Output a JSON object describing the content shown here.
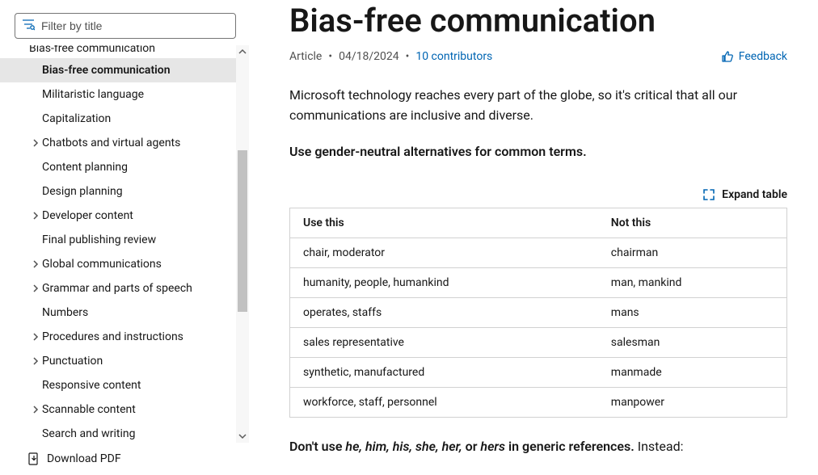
{
  "filter": {
    "placeholder": "Filter by title"
  },
  "sidebar": {
    "truncated_top": "Bias-free communication",
    "items": [
      {
        "label": "Bias-free communication",
        "indent": 2,
        "caret": false,
        "selected": true
      },
      {
        "label": "Militaristic language",
        "indent": 2,
        "caret": false,
        "selected": false
      },
      {
        "label": "Capitalization",
        "indent": 1,
        "caret": false,
        "selected": false
      },
      {
        "label": "Chatbots and virtual agents",
        "indent": 1,
        "caret": true,
        "selected": false
      },
      {
        "label": "Content planning",
        "indent": 1,
        "caret": false,
        "selected": false
      },
      {
        "label": "Design planning",
        "indent": 1,
        "caret": false,
        "selected": false
      },
      {
        "label": "Developer content",
        "indent": 1,
        "caret": true,
        "selected": false
      },
      {
        "label": "Final publishing review",
        "indent": 1,
        "caret": false,
        "selected": false
      },
      {
        "label": "Global communications",
        "indent": 1,
        "caret": true,
        "selected": false
      },
      {
        "label": "Grammar and parts of speech",
        "indent": 1,
        "caret": true,
        "selected": false
      },
      {
        "label": "Numbers",
        "indent": 1,
        "caret": false,
        "selected": false
      },
      {
        "label": "Procedures and instructions",
        "indent": 1,
        "caret": true,
        "selected": false
      },
      {
        "label": "Punctuation",
        "indent": 1,
        "caret": true,
        "selected": false
      },
      {
        "label": "Responsive content",
        "indent": 1,
        "caret": false,
        "selected": false
      },
      {
        "label": "Scannable content",
        "indent": 1,
        "caret": true,
        "selected": false
      },
      {
        "label": "Search and writing",
        "indent": 1,
        "caret": false,
        "selected": false
      }
    ],
    "download": "Download PDF"
  },
  "article": {
    "title": "Bias-free communication",
    "kind": "Article",
    "date": "04/18/2024",
    "contributors": "10 contributors",
    "feedback": "Feedback",
    "intro": "Microsoft technology reaches every part of the globe, so it's critical that all our communications are inclusive and diverse.",
    "lead": "Use gender-neutral alternatives for common terms.",
    "expand": "Expand table",
    "table": {
      "head_a": "Use this",
      "head_b": "Not this",
      "rows": [
        {
          "a": "chair, moderator",
          "b": "chairman"
        },
        {
          "a": "humanity, people, humankind",
          "b": "man, mankind"
        },
        {
          "a": "operates, staffs",
          "b": "mans"
        },
        {
          "a": "sales representative",
          "b": "salesman"
        },
        {
          "a": "synthetic, manufactured",
          "b": "manmade"
        },
        {
          "a": "workforce, staff, personnel",
          "b": "manpower"
        }
      ]
    },
    "closing_bold": "Don't use ",
    "closing_italic": "he, him, his, she, her,",
    "closing_or": " or ",
    "closing_italic2": "hers",
    "closing_rest": " in generic references.",
    "closing_tail": " Instead:"
  }
}
